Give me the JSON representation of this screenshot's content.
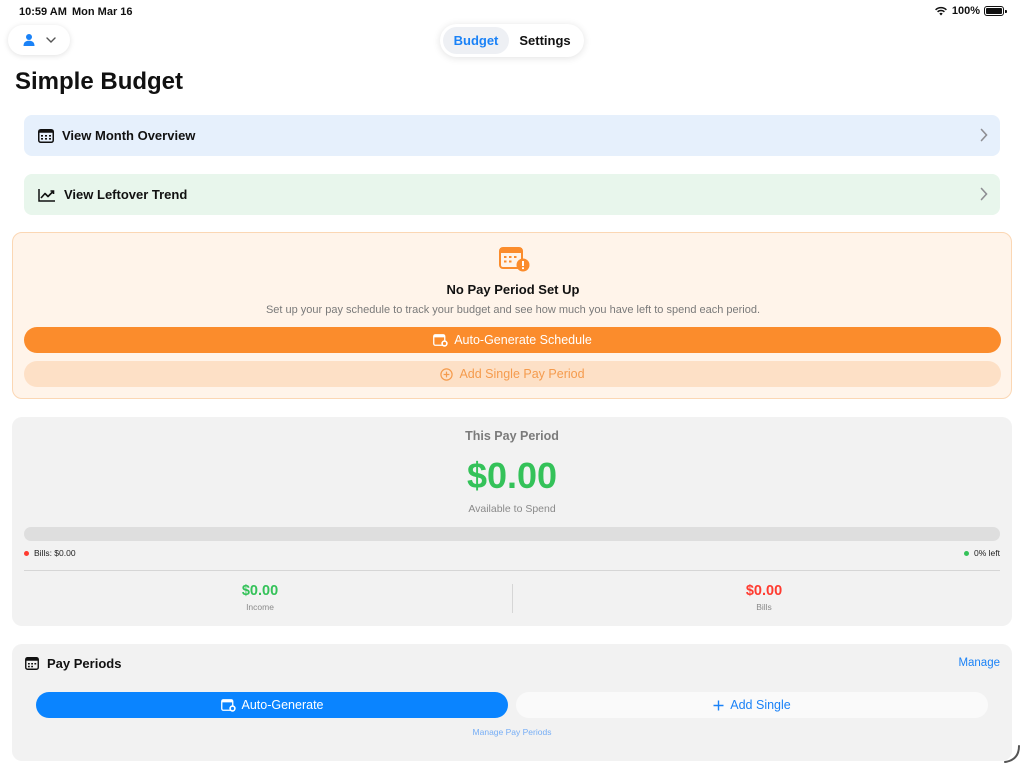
{
  "status": {
    "time": "10:59 AM",
    "date": "Mon Mar 16",
    "battery": "100%"
  },
  "header": {
    "tabs": [
      {
        "label": "Budget",
        "selected": true
      },
      {
        "label": "Settings",
        "selected": false
      }
    ],
    "account_icon": "person-icon"
  },
  "title": "Simple Budget",
  "nav": {
    "month_overview": "View Month Overview",
    "leftover_trend": "View Leftover Trend"
  },
  "alert": {
    "title": "No Pay Period Set Up",
    "description": "Set up your pay schedule to track your budget and see how much you have left to spend each period.",
    "primary_button": "Auto-Generate Schedule",
    "secondary_button": "Add Single Pay Period"
  },
  "pay_period": {
    "title": "This Pay Period",
    "amount": "$0.00",
    "subtitle": "Available to Spend",
    "progress_fraction": 0,
    "bills_legend": "Bills: $0.00",
    "left_legend": "0% left",
    "income_value": "$0.00",
    "income_label": "Income",
    "bills_value": "$0.00",
    "bills_label": "Bills"
  },
  "pay_periods_section": {
    "title": "Pay Periods",
    "manage": "Manage",
    "auto_button": "Auto-Generate",
    "single_button": "Add Single",
    "manage_link": "Manage Pay Periods"
  },
  "colors": {
    "accent_blue": "#0a84ff",
    "accent_orange": "#fb8c2c",
    "income_green": "#34c259",
    "bills_red": "#ff3b30"
  }
}
